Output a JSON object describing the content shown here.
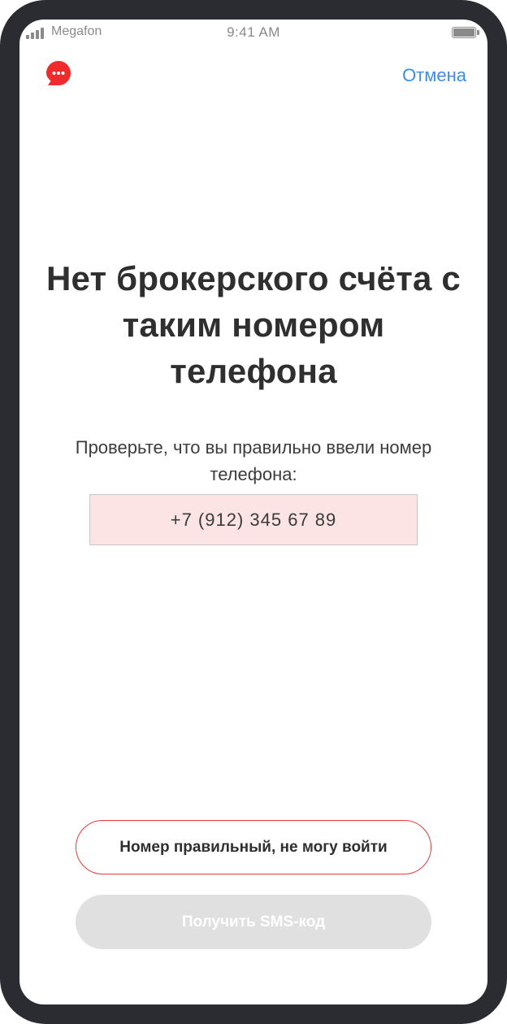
{
  "status_bar": {
    "carrier": "Megafon",
    "time": "9:41 AM"
  },
  "nav": {
    "chat_icon": "chat-bubble-icon",
    "cancel_label": "Отмена"
  },
  "content": {
    "title": "Нет брокерского счёта с таким номером телефона",
    "subtitle": "Проверьте, что вы правильно ввели номер телефона:",
    "phone_number": "+7 (912) 345 67 89"
  },
  "actions": {
    "correct_number_label": "Номер правильный, не могу войти",
    "get_sms_label": "Получить SMS-код",
    "get_sms_disabled": true
  },
  "colors": {
    "accent_red": "#e53b3b",
    "link_blue": "#3a8ee6",
    "phone_highlight": "#fde4e4",
    "disabled_button": "#e0e0e0"
  }
}
